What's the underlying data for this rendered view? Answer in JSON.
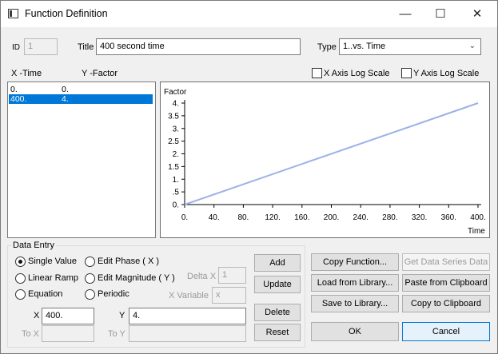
{
  "window": {
    "title": "Function Definition",
    "minimize": "—",
    "maximize": "☐",
    "close": "✕"
  },
  "header": {
    "id_label": "ID",
    "id_value": "1",
    "title_label": "Title",
    "title_value": "400 second time",
    "type_label": "Type",
    "type_value": "1..vs. Time"
  },
  "list": {
    "x_header": "X -Time",
    "y_header": "Y -Factor",
    "rows": [
      {
        "x": "0.",
        "y": "0."
      },
      {
        "x": "400.",
        "y": "4."
      }
    ]
  },
  "options": {
    "x_log_label": "X Axis Log Scale",
    "y_log_label": "Y Axis Log Scale"
  },
  "chart_data": {
    "type": "line",
    "ylabel": "Factor",
    "xlabel": "Time",
    "x": [
      0,
      400
    ],
    "series": [
      {
        "values": [
          0,
          4
        ],
        "color": "#9db0e8"
      }
    ],
    "xlim": [
      0,
      400
    ],
    "ylim": [
      0,
      4
    ],
    "xticks": [
      "0.",
      "40.",
      "80.",
      "120.",
      "160.",
      "200.",
      "240.",
      "280.",
      "320.",
      "360.",
      "400."
    ],
    "yticks": [
      "0.",
      ".5",
      "1.",
      "1.5",
      "2.",
      "2.5",
      "3.",
      "3.5",
      "4."
    ],
    "grid": false
  },
  "entry": {
    "group_label": "Data Entry",
    "single_value": "Single Value",
    "linear_ramp": "Linear Ramp",
    "equation": "Equation",
    "edit_phase": "Edit Phase ( X )",
    "edit_magnitude": "Edit Magnitude ( Y )",
    "periodic": "Periodic",
    "delta_x_label": "Delta X",
    "delta_x_value": "1",
    "x_variable_label": "X Variable",
    "x_variable_value": "x",
    "x_label": "X",
    "x_value": "400.",
    "y_label": "Y",
    "y_value": "4.",
    "to_x_label": "To X",
    "to_y_label": "To Y"
  },
  "buttons": {
    "add": "Add",
    "update": "Update",
    "delete": "Delete",
    "reset": "Reset",
    "copy_function": "Copy Function...",
    "get_data_series": "Get Data Series Data",
    "load_library": "Load from Library...",
    "paste_clipboard": "Paste from Clipboard",
    "save_library": "Save to Library...",
    "copy_clipboard": "Copy to Clipboard",
    "ok": "OK",
    "cancel": "Cancel"
  }
}
